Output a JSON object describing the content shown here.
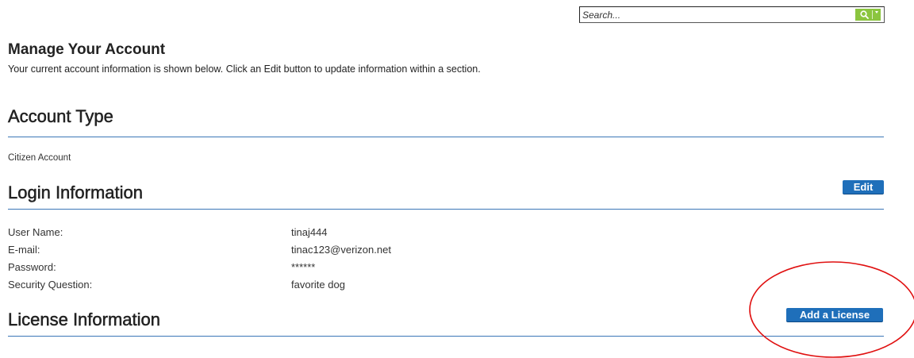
{
  "search": {
    "placeholder": "Search..."
  },
  "page": {
    "title": "Manage Your Account",
    "subtitle": "Your current account information is shown below. Click an Edit button to update information within a section."
  },
  "account_type": {
    "heading": "Account Type",
    "value": "Citizen Account"
  },
  "login": {
    "heading": "Login Information",
    "edit_label": "Edit",
    "fields": [
      {
        "label": "User Name:",
        "value": "tinaj444"
      },
      {
        "label": "E-mail:",
        "value": "tinac123@verizon.net"
      },
      {
        "label": "Password:",
        "value": "******"
      },
      {
        "label": "Security Question:",
        "value": "favorite dog"
      }
    ]
  },
  "license": {
    "heading": "License Information",
    "add_label": "Add a License"
  },
  "colors": {
    "accent_blue": "#1f6fba",
    "rule_blue": "#3b77b7",
    "search_green": "#8bc53f",
    "annotation_red": "#e01010"
  }
}
